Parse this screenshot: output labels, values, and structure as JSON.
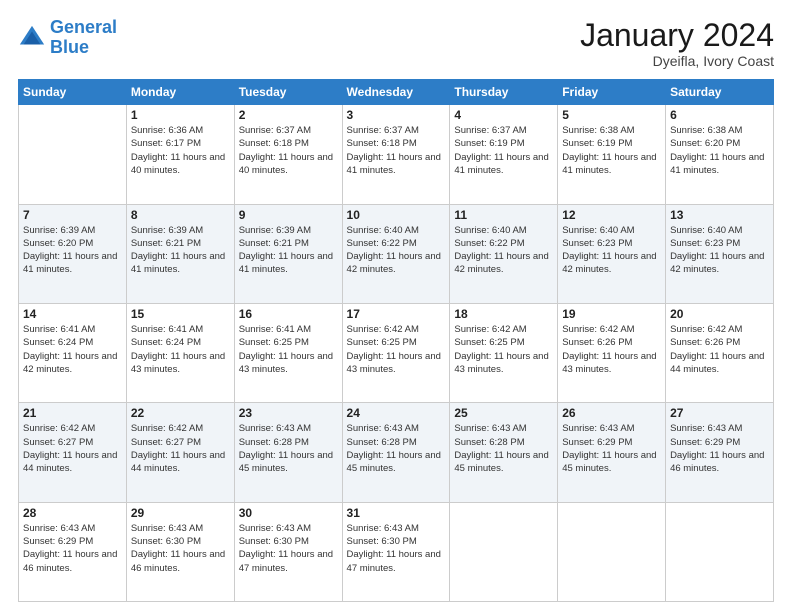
{
  "header": {
    "logo_line1": "General",
    "logo_line2": "Blue",
    "month_title": "January 2024",
    "location": "Dyeifla, Ivory Coast"
  },
  "weekdays": [
    "Sunday",
    "Monday",
    "Tuesday",
    "Wednesday",
    "Thursday",
    "Friday",
    "Saturday"
  ],
  "rows": [
    {
      "alt": false,
      "cells": [
        {
          "day": "",
          "sunrise": "",
          "sunset": "",
          "daylight": ""
        },
        {
          "day": "1",
          "sunrise": "Sunrise: 6:36 AM",
          "sunset": "Sunset: 6:17 PM",
          "daylight": "Daylight: 11 hours and 40 minutes."
        },
        {
          "day": "2",
          "sunrise": "Sunrise: 6:37 AM",
          "sunset": "Sunset: 6:18 PM",
          "daylight": "Daylight: 11 hours and 40 minutes."
        },
        {
          "day": "3",
          "sunrise": "Sunrise: 6:37 AM",
          "sunset": "Sunset: 6:18 PM",
          "daylight": "Daylight: 11 hours and 41 minutes."
        },
        {
          "day": "4",
          "sunrise": "Sunrise: 6:37 AM",
          "sunset": "Sunset: 6:19 PM",
          "daylight": "Daylight: 11 hours and 41 minutes."
        },
        {
          "day": "5",
          "sunrise": "Sunrise: 6:38 AM",
          "sunset": "Sunset: 6:19 PM",
          "daylight": "Daylight: 11 hours and 41 minutes."
        },
        {
          "day": "6",
          "sunrise": "Sunrise: 6:38 AM",
          "sunset": "Sunset: 6:20 PM",
          "daylight": "Daylight: 11 hours and 41 minutes."
        }
      ]
    },
    {
      "alt": true,
      "cells": [
        {
          "day": "7",
          "sunrise": "Sunrise: 6:39 AM",
          "sunset": "Sunset: 6:20 PM",
          "daylight": "Daylight: 11 hours and 41 minutes."
        },
        {
          "day": "8",
          "sunrise": "Sunrise: 6:39 AM",
          "sunset": "Sunset: 6:21 PM",
          "daylight": "Daylight: 11 hours and 41 minutes."
        },
        {
          "day": "9",
          "sunrise": "Sunrise: 6:39 AM",
          "sunset": "Sunset: 6:21 PM",
          "daylight": "Daylight: 11 hours and 41 minutes."
        },
        {
          "day": "10",
          "sunrise": "Sunrise: 6:40 AM",
          "sunset": "Sunset: 6:22 PM",
          "daylight": "Daylight: 11 hours and 42 minutes."
        },
        {
          "day": "11",
          "sunrise": "Sunrise: 6:40 AM",
          "sunset": "Sunset: 6:22 PM",
          "daylight": "Daylight: 11 hours and 42 minutes."
        },
        {
          "day": "12",
          "sunrise": "Sunrise: 6:40 AM",
          "sunset": "Sunset: 6:23 PM",
          "daylight": "Daylight: 11 hours and 42 minutes."
        },
        {
          "day": "13",
          "sunrise": "Sunrise: 6:40 AM",
          "sunset": "Sunset: 6:23 PM",
          "daylight": "Daylight: 11 hours and 42 minutes."
        }
      ]
    },
    {
      "alt": false,
      "cells": [
        {
          "day": "14",
          "sunrise": "Sunrise: 6:41 AM",
          "sunset": "Sunset: 6:24 PM",
          "daylight": "Daylight: 11 hours and 42 minutes."
        },
        {
          "day": "15",
          "sunrise": "Sunrise: 6:41 AM",
          "sunset": "Sunset: 6:24 PM",
          "daylight": "Daylight: 11 hours and 43 minutes."
        },
        {
          "day": "16",
          "sunrise": "Sunrise: 6:41 AM",
          "sunset": "Sunset: 6:25 PM",
          "daylight": "Daylight: 11 hours and 43 minutes."
        },
        {
          "day": "17",
          "sunrise": "Sunrise: 6:42 AM",
          "sunset": "Sunset: 6:25 PM",
          "daylight": "Daylight: 11 hours and 43 minutes."
        },
        {
          "day": "18",
          "sunrise": "Sunrise: 6:42 AM",
          "sunset": "Sunset: 6:25 PM",
          "daylight": "Daylight: 11 hours and 43 minutes."
        },
        {
          "day": "19",
          "sunrise": "Sunrise: 6:42 AM",
          "sunset": "Sunset: 6:26 PM",
          "daylight": "Daylight: 11 hours and 43 minutes."
        },
        {
          "day": "20",
          "sunrise": "Sunrise: 6:42 AM",
          "sunset": "Sunset: 6:26 PM",
          "daylight": "Daylight: 11 hours and 44 minutes."
        }
      ]
    },
    {
      "alt": true,
      "cells": [
        {
          "day": "21",
          "sunrise": "Sunrise: 6:42 AM",
          "sunset": "Sunset: 6:27 PM",
          "daylight": "Daylight: 11 hours and 44 minutes."
        },
        {
          "day": "22",
          "sunrise": "Sunrise: 6:42 AM",
          "sunset": "Sunset: 6:27 PM",
          "daylight": "Daylight: 11 hours and 44 minutes."
        },
        {
          "day": "23",
          "sunrise": "Sunrise: 6:43 AM",
          "sunset": "Sunset: 6:28 PM",
          "daylight": "Daylight: 11 hours and 45 minutes."
        },
        {
          "day": "24",
          "sunrise": "Sunrise: 6:43 AM",
          "sunset": "Sunset: 6:28 PM",
          "daylight": "Daylight: 11 hours and 45 minutes."
        },
        {
          "day": "25",
          "sunrise": "Sunrise: 6:43 AM",
          "sunset": "Sunset: 6:28 PM",
          "daylight": "Daylight: 11 hours and 45 minutes."
        },
        {
          "day": "26",
          "sunrise": "Sunrise: 6:43 AM",
          "sunset": "Sunset: 6:29 PM",
          "daylight": "Daylight: 11 hours and 45 minutes."
        },
        {
          "day": "27",
          "sunrise": "Sunrise: 6:43 AM",
          "sunset": "Sunset: 6:29 PM",
          "daylight": "Daylight: 11 hours and 46 minutes."
        }
      ]
    },
    {
      "alt": false,
      "cells": [
        {
          "day": "28",
          "sunrise": "Sunrise: 6:43 AM",
          "sunset": "Sunset: 6:29 PM",
          "daylight": "Daylight: 11 hours and 46 minutes."
        },
        {
          "day": "29",
          "sunrise": "Sunrise: 6:43 AM",
          "sunset": "Sunset: 6:30 PM",
          "daylight": "Daylight: 11 hours and 46 minutes."
        },
        {
          "day": "30",
          "sunrise": "Sunrise: 6:43 AM",
          "sunset": "Sunset: 6:30 PM",
          "daylight": "Daylight: 11 hours and 47 minutes."
        },
        {
          "day": "31",
          "sunrise": "Sunrise: 6:43 AM",
          "sunset": "Sunset: 6:30 PM",
          "daylight": "Daylight: 11 hours and 47 minutes."
        },
        {
          "day": "",
          "sunrise": "",
          "sunset": "",
          "daylight": ""
        },
        {
          "day": "",
          "sunrise": "",
          "sunset": "",
          "daylight": ""
        },
        {
          "day": "",
          "sunrise": "",
          "sunset": "",
          "daylight": ""
        }
      ]
    }
  ]
}
